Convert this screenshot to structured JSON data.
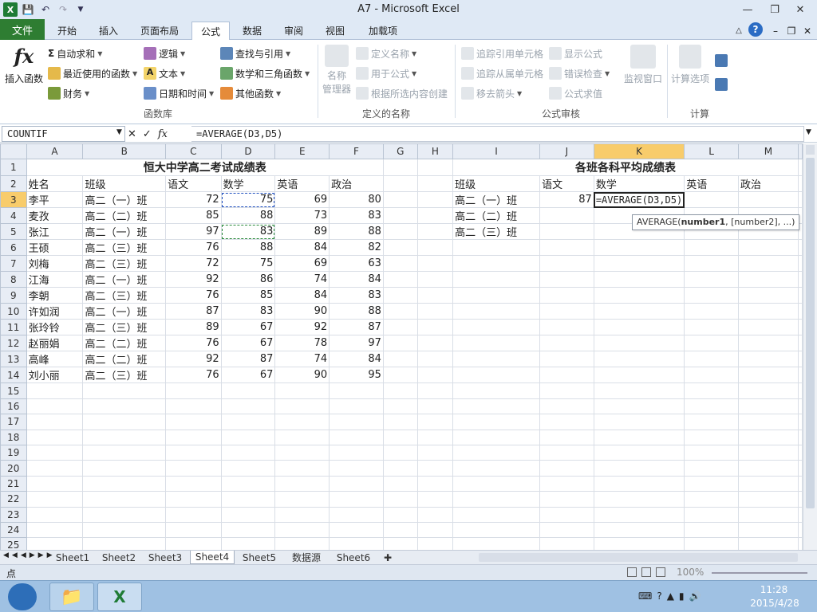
{
  "window": {
    "title": "A7 - Microsoft Excel"
  },
  "qat_icons": [
    "save-icon",
    "undo-icon",
    "redo-icon"
  ],
  "tabs": [
    "文件",
    "开始",
    "插入",
    "页面布局",
    "公式",
    "数据",
    "审阅",
    "视图",
    "加载项"
  ],
  "ribbon": {
    "insert_function": "插入函数",
    "autosum": "自动求和",
    "recent": "最近使用的函数",
    "finance": "财务",
    "logical": "逻辑",
    "text": "文本",
    "datetime": "日期和时间",
    "lookup": "查找与引用",
    "mathtrig": "数学和三角函数",
    "other": "其他函数",
    "group_library": "函数库",
    "name_manager_1": "名称",
    "name_manager_2": "管理器",
    "define_name": "定义名称",
    "use_in_formula": "用于公式",
    "create_from_sel": "根据所选内容创建",
    "group_names": "定义的名称",
    "trace_precedents": "追踪引用单元格",
    "trace_dependents": "追踪从属单元格",
    "remove_arrows": "移去箭头",
    "show_formulas": "显示公式",
    "error_check": "错误检查",
    "evaluate": "公式求值",
    "group_audit": "公式审核",
    "watch_window": "监视窗口",
    "calc_options": "计算选项",
    "group_calc": "计算"
  },
  "formula_bar": {
    "name_box": "COUNTIF",
    "formula": "=AVERAGE(D3,D5)"
  },
  "columns": [
    "A",
    "B",
    "C",
    "D",
    "E",
    "F",
    "G",
    "H",
    "I",
    "J",
    "K",
    "L",
    "M"
  ],
  "rows": [
    "1",
    "2",
    "3",
    "4",
    "5",
    "6",
    "7",
    "8",
    "9",
    "10",
    "11",
    "12",
    "13",
    "14",
    "15",
    "16",
    "17",
    "18",
    "19",
    "20",
    "21",
    "22",
    "23",
    "24",
    "25"
  ],
  "sheet": {
    "title_left": "恒大中学高二考试成绩表",
    "title_right": "各班各科平均成绩表",
    "headers_left": [
      "姓名",
      "班级",
      "语文",
      "数学",
      "英语",
      "政治"
    ],
    "headers_right": [
      "班级",
      "语文",
      "数学",
      "英语",
      "政治"
    ],
    "students": [
      [
        "李平",
        "高二（一）班",
        "72",
        "75",
        "69",
        "80"
      ],
      [
        "麦孜",
        "高二（二）班",
        "85",
        "88",
        "73",
        "83"
      ],
      [
        "张江",
        "高二（一）班",
        "97",
        "83",
        "89",
        "88"
      ],
      [
        "王硕",
        "高二（三）班",
        "76",
        "88",
        "84",
        "82"
      ],
      [
        "刘梅",
        "高二（三）班",
        "72",
        "75",
        "69",
        "63"
      ],
      [
        "江海",
        "高二（一）班",
        "92",
        "86",
        "74",
        "84"
      ],
      [
        "李朝",
        "高二（三）班",
        "76",
        "85",
        "84",
        "83"
      ],
      [
        "许如润",
        "高二（一）班",
        "87",
        "83",
        "90",
        "88"
      ],
      [
        "张玲铃",
        "高二（三）班",
        "89",
        "67",
        "92",
        "87"
      ],
      [
        "赵丽娟",
        "高二（二）班",
        "76",
        "67",
        "78",
        "97"
      ],
      [
        "高峰",
        "高二（二）班",
        "92",
        "87",
        "74",
        "84"
      ],
      [
        "刘小丽",
        "高二（三）班",
        "76",
        "67",
        "90",
        "95"
      ]
    ],
    "classes": [
      "高二（一）班",
      "高二（二）班",
      "高二（三）班"
    ],
    "j3": "87",
    "k3_editing": "=AVERAGE(D3,D5)"
  },
  "tooltip": {
    "fn": "AVERAGE(",
    "arg1": "number1",
    "rest": ", [number2], ...)"
  },
  "sheet_tabs": [
    "Sheet1",
    "Sheet2",
    "Sheet3",
    "Sheet4",
    "Sheet5",
    "数据源",
    "Sheet6"
  ],
  "active_sheet": "Sheet4",
  "status": {
    "mode": "点",
    "zoom": "100%"
  },
  "clock": {
    "time": "11:28",
    "date": "2015/4/28"
  }
}
